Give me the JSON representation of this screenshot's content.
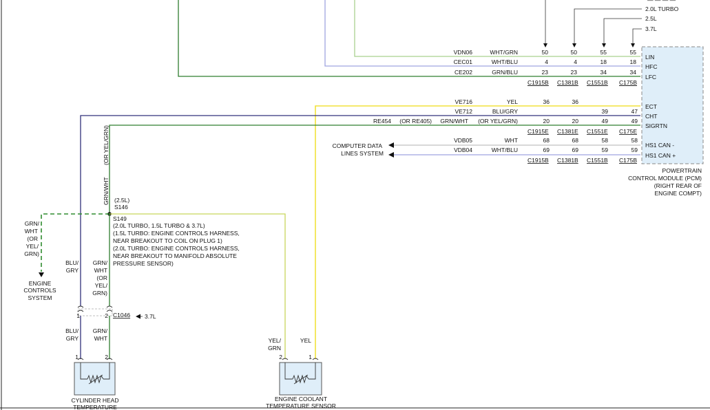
{
  "variants": [
    "2.0L TURBO",
    "2.5L",
    "3.7L"
  ],
  "pcm": {
    "pins_group1": [
      "LIN",
      "HFC",
      "LFC"
    ],
    "pins_group2": [
      "ECT",
      "CHT",
      "SIGRTN"
    ],
    "pins_group3": [
      "HS1 CAN -",
      "HS1 CAN +"
    ],
    "label": [
      "POWERTRAIN",
      "CONTROL MODULE (PCM)",
      "(RIGHT REAR OF",
      "ENGINE COMPT)"
    ]
  },
  "circuits": [
    {
      "id": "VDN06",
      "color": "WHT/GRN",
      "pins": [
        "50",
        "50",
        "55",
        "55"
      ]
    },
    {
      "id": "CEC01",
      "color": "WHT/BLU",
      "pins": [
        "4",
        "4",
        "18",
        "18"
      ]
    },
    {
      "id": "CE202",
      "color": "GRN/BLU",
      "pins": [
        "23",
        "23",
        "34",
        "34"
      ]
    },
    {
      "id": "VE716",
      "color": "YEL",
      "pins": [
        "36",
        "36",
        "",
        ""
      ]
    },
    {
      "id": "VE712",
      "color": "BLU/GRY",
      "pins": [
        "",
        "",
        "39",
        "47"
      ]
    },
    {
      "id": "RE454",
      "alt": "(OR RE405)",
      "color": "GRN/WHT",
      "alt_color": "(OR YEL/GRN)",
      "pins": [
        "20",
        "20",
        "49",
        "49"
      ]
    },
    {
      "id": "VDB05",
      "color": "WHT",
      "pins": [
        "68",
        "68",
        "58",
        "58"
      ]
    },
    {
      "id": "VDB04",
      "color": "WHT/BLU",
      "pins": [
        "69",
        "69",
        "59",
        "59"
      ]
    }
  ],
  "connectors_row1": [
    "C1915B",
    "C1381B",
    "C1551B",
    "C175B"
  ],
  "connectors_row2": [
    "C1915E",
    "C1381E",
    "C1551E",
    "C175E"
  ],
  "connectors_row3": [
    "C1915B",
    "C1381B",
    "C1551B",
    "C175B"
  ],
  "computer_data": [
    "COMPUTER DATA",
    "LINES SYSTEM"
  ],
  "vertical_label_upper": "(OR YEL/GRN)",
  "vertical_label_lower": "GRN/WHT",
  "splice": {
    "s146": [
      "(2.5L)",
      "S146"
    ],
    "s149": [
      "S149",
      "(2.0L TURBO, 1.5L TURBO & 3.7L)",
      "(1.5L TURBO: ENGINE CONTROLS HARNESS,",
      "NEAR BREAKOUT TO COIL ON PLUG 1)",
      "(2.0L TURBO: ENGINE CONTROLS HARNESS,",
      "NEAR BREAKOUT TO MANIFOLD ABSOLUTE",
      "PRESSURE SENSOR)"
    ]
  },
  "left_branch": {
    "wire": [
      "GRN/",
      "WHT",
      "(OR",
      "YEL/",
      "GRN)"
    ],
    "dest": [
      "ENGINE",
      "CONTROLS",
      "SYSTEM"
    ]
  },
  "cht_wires_upper": {
    "left": [
      "BLU/",
      "GRY"
    ],
    "right": [
      "GRN/",
      "WHT",
      "(OR",
      "YEL/",
      "GRN)"
    ]
  },
  "c1046": {
    "name": "C1046",
    "variant": "3.7L",
    "pin_left": "1",
    "pin_right": "2"
  },
  "cht_wires_lower": {
    "left": [
      "BLU/",
      "GRY"
    ],
    "right": [
      "GRN/",
      "WHT"
    ]
  },
  "cht_sensor": {
    "pins": [
      "1",
      "2"
    ],
    "label": [
      "CYLINDER HEAD",
      "TEMPERATURE"
    ]
  },
  "ect_wires": {
    "left": [
      "YEL/",
      "GRN"
    ],
    "right": "YEL"
  },
  "ect_sensor": {
    "pins": [
      "2",
      "1"
    ],
    "label": [
      "ENGINE COOLANT",
      "TEMPERATURE SENSOR"
    ]
  }
}
